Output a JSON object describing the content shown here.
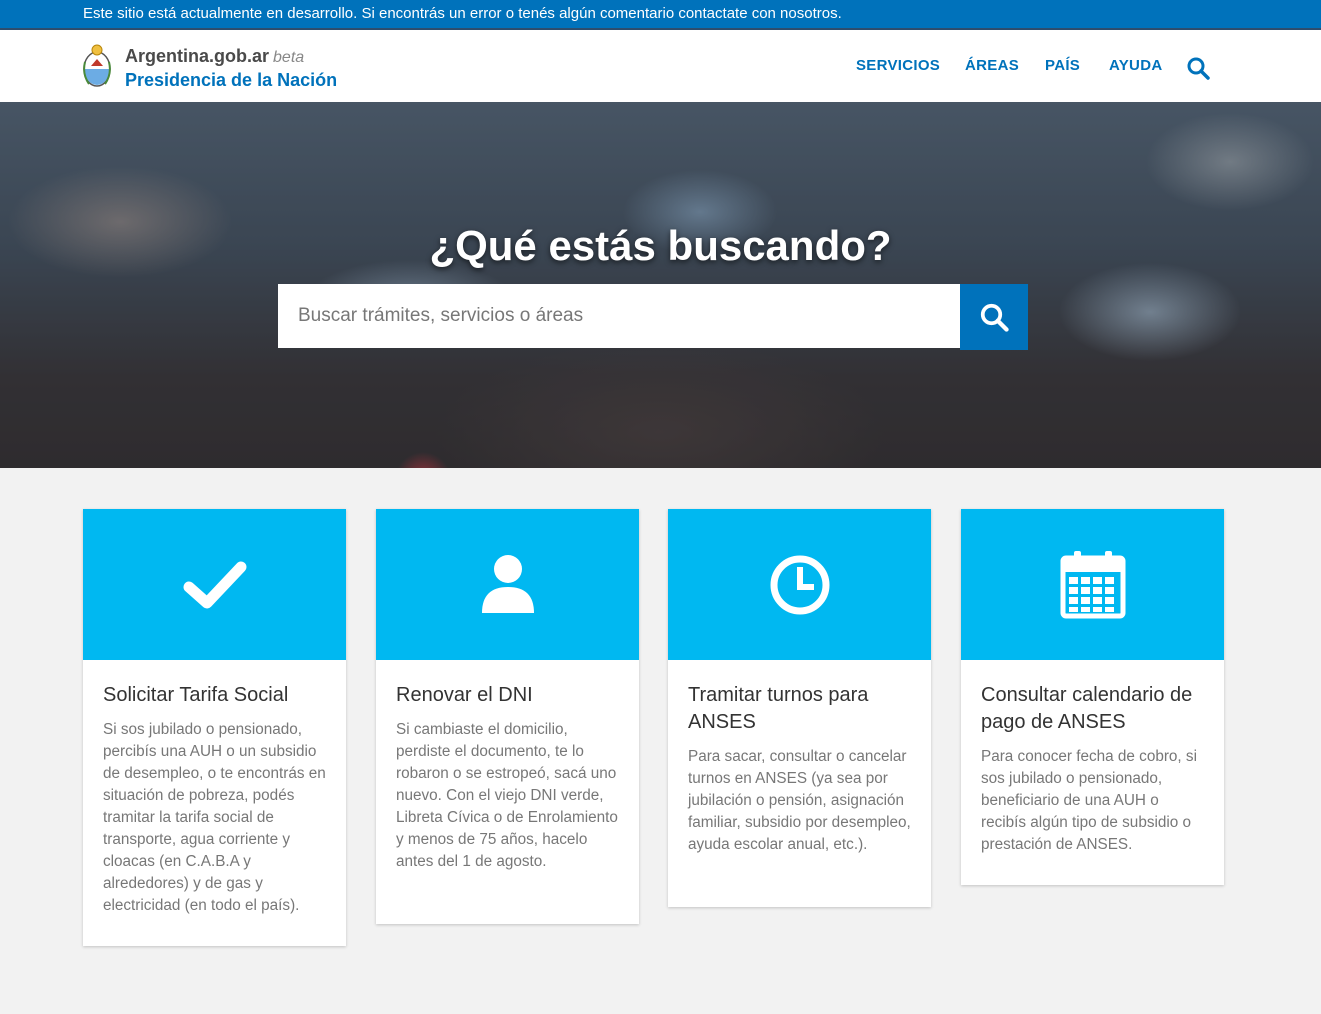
{
  "banner": {
    "text": "Este sitio está actualmente en desarrollo. Si encontrás un error o tenés algún comentario contactate con nosotros."
  },
  "brand": {
    "site": "Argentina.gob.ar",
    "beta": "beta",
    "org": "Presidencia de la Nación"
  },
  "nav": {
    "items": [
      "SERVICIOS",
      "ÁREAS",
      "PAÍS",
      "AYUDA"
    ],
    "search_icon": "search-icon"
  },
  "hero": {
    "title": "¿Qué estás buscando?",
    "placeholder": "Buscar trámites, servicios o áreas",
    "search_value": ""
  },
  "colors": {
    "primary": "#0072bb",
    "card_accent": "#00b8f1",
    "page_bg": "#f2f2f2"
  },
  "cards": [
    {
      "icon": "checkmark-icon",
      "title": "Solicitar Tarifa Social",
      "text": "Si sos jubilado o pensionado, percibís una AUH o un subsidio de desempleo, o te encontrás en situación de pobreza, podés tramitar la tarifa social de transporte, agua corriente y cloacas (en C.A.B.A y alrededores) y de gas y electricidad (en todo el país)."
    },
    {
      "icon": "user-icon",
      "title": "Renovar el DNI",
      "text": "Si cambiaste el domicilio, perdiste el documento, te lo robaron o se estropeó, sacá uno nuevo. Con el viejo DNI verde, Libreta Cívica o de Enrolamiento y menos de 75 años, hacelo antes del 1 de agosto."
    },
    {
      "icon": "clock-icon",
      "title": "Tramitar turnos para ANSES",
      "text": "Para sacar, consultar o cancelar turnos en ANSES (ya sea por jubilación o pensión, asignación familiar, subsidio por desempleo, ayuda escolar anual, etc.)."
    },
    {
      "icon": "calendar-icon",
      "title": "Consultar calendario de pago de ANSES",
      "text": "Para conocer fecha de cobro, si sos jubilado o pensionado, beneficiario de una AUH o recibís algún tipo de subsidio o prestación de ANSES."
    }
  ]
}
